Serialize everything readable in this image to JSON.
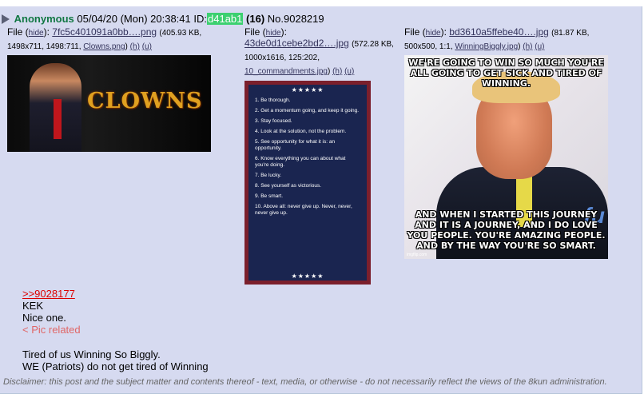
{
  "post": {
    "name": "Anonymous",
    "date": "05/04/20 (Mon) 20:38:41",
    "id_label": "ID:",
    "id": "d41ab1",
    "count": "(16)",
    "number": "No.9028219"
  },
  "files": [
    {
      "label": "File (",
      "hide": "hide",
      "sep": "):",
      "name": "7fc5c401091a0bb….png",
      "meta_pre": "(405.93 KB, 1498x711, 1498:711,",
      "orig": "Clowns.png",
      "meta_post": ")",
      "h": "(h)",
      "u": "(u)"
    },
    {
      "label": "File (",
      "hide": "hide",
      "sep": "):",
      "name": "43de0d1cebe2bd2….jpg",
      "meta_pre": "(572.28 KB, 1000x1616, 125:202,",
      "orig": "10_commandments.jpg",
      "meta_post": ")",
      "h": "(h)",
      "u": "(u)"
    },
    {
      "label": "File (",
      "hide": "hide",
      "sep": "):",
      "name": "bd3610a5ffebe40….jpg",
      "meta_pre": "(81.87 KB, 500x500, 1:1,",
      "orig": "WinningBiggly.jpg",
      "meta_post": ")",
      "h": "(h)",
      "u": "(u)"
    }
  ],
  "images": {
    "clowns_text": "CLOWNS",
    "commandments": {
      "stars_top": "★★★★★",
      "stars_bottom": "★★★★★",
      "items": [
        "1. Be thorough.",
        "2. Get a momentum going, and keep it going.",
        "3. Stay focused.",
        "4. Look at the solution, not the problem.",
        "5. See opportunity for what it is: an opportunity.",
        "6. Know everything you can about what you're doing.",
        "7. Be lucky.",
        "8. See yourself as victorious.",
        "9. Be smart.",
        "10. Above all: never give up. Never, never, never give up."
      ]
    },
    "meme": {
      "top": "WE'RE GOING TO WIN SO MUCH YOU'RE ALL GOING TO GET SICK AND TIRED OF WINNING.",
      "bottom": "AND WHEN I STARTED THIS JOURNEY AND IT IS A JOURNEY, AND I DO LOVE YOU PEOPLE. YOU'RE AMAZING PEOPLE. AND BY THE WAY YOU'RE SO SMART.",
      "fu": "fu",
      "watermark": "imgflip.com"
    }
  },
  "body": {
    "quote": ">>9028177",
    "line1": "KEK",
    "line2": "Nice one.",
    "greentext": "< Pic related",
    "line3": "Tired of us Winning So Biggly.",
    "line4": "WE (Patriots) do not get tired of Winning"
  },
  "disclaimer": "Disclaimer: this post and the subject matter and contents thereof - text, media, or otherwise - do not necessarily reflect the views of the 8kun administration."
}
